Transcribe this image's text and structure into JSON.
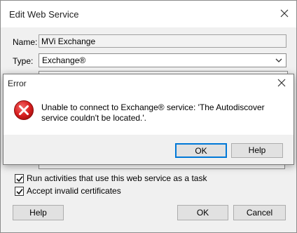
{
  "main_dialog": {
    "title": "Edit Web Service",
    "name_label": "Name:",
    "name_value": "MVi Exchange",
    "type_label": "Type:",
    "type_value": "Exchange®",
    "run_as_task_label": "Run activities that use this web service as a task",
    "run_as_task_checked": true,
    "accept_invalid_label": "Accept invalid certificates",
    "accept_invalid_checked": true,
    "help_button": "Help",
    "ok_button": "OK",
    "cancel_button": "Cancel"
  },
  "error_dialog": {
    "title": "Error",
    "message": "Unable to connect to Exchange® service: 'The Autodiscover service couldn't be located.'.",
    "ok_button": "OK",
    "help_button": "Help"
  },
  "colors": {
    "error_icon": "#e81123",
    "focus_border": "#0078d7"
  },
  "icons": {
    "close": "close-icon",
    "error": "error-icon",
    "dropdown": "chevron-down-icon",
    "check": "checkmark-icon"
  }
}
